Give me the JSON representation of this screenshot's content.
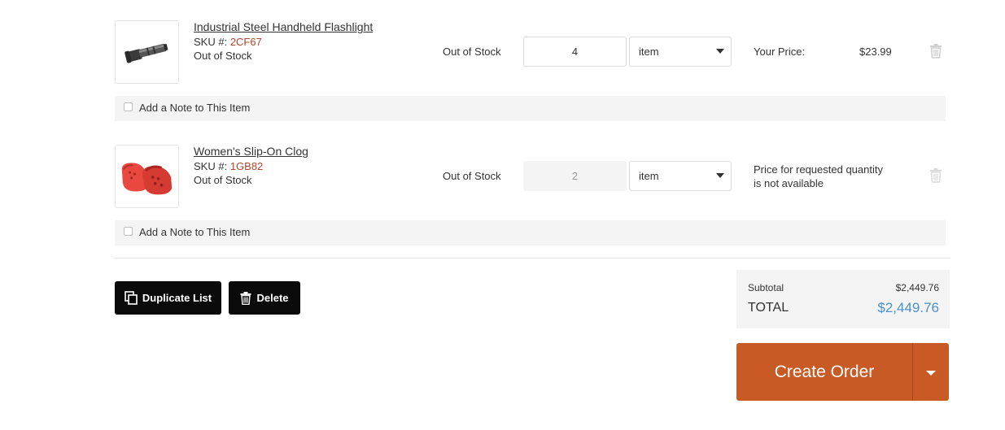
{
  "cart_items": [
    {
      "name": "Industrial Steel Handheld Flashlight",
      "sku_label": "SKU #:",
      "sku": "2CF67",
      "stock_status": "Out of Stock",
      "availability": "Out of Stock",
      "quantity": "4",
      "unit": "item",
      "price_label": "Your Price:",
      "price": "$23.99",
      "note_label": "Add a Note to This Item",
      "image_icon": "flashlight-image"
    },
    {
      "name": "Women's Slip-On Clog",
      "sku_label": "SKU #:",
      "sku": "1GB82",
      "stock_status": "Out of Stock",
      "availability": "Out of Stock",
      "quantity": "2",
      "unit": "item",
      "price_unavailable_line1": "Price for requested quantity",
      "price_unavailable_line2": "is not available",
      "note_label": "Add a Note to This Item",
      "image_icon": "clog-image"
    }
  ],
  "actions": {
    "duplicate_label": "Duplicate List",
    "delete_label": "Delete"
  },
  "totals": {
    "subtotal_label": "Subtotal",
    "subtotal_value": "$2,449.76",
    "total_label": "TOTAL",
    "total_value": "$2,449.76"
  },
  "create_order": {
    "label": "Create Order"
  },
  "colors": {
    "accent_orange": "#c85a26",
    "total_blue": "#4a90c9",
    "sku_red": "#b0452b",
    "button_dark": "#0a0a0a"
  }
}
